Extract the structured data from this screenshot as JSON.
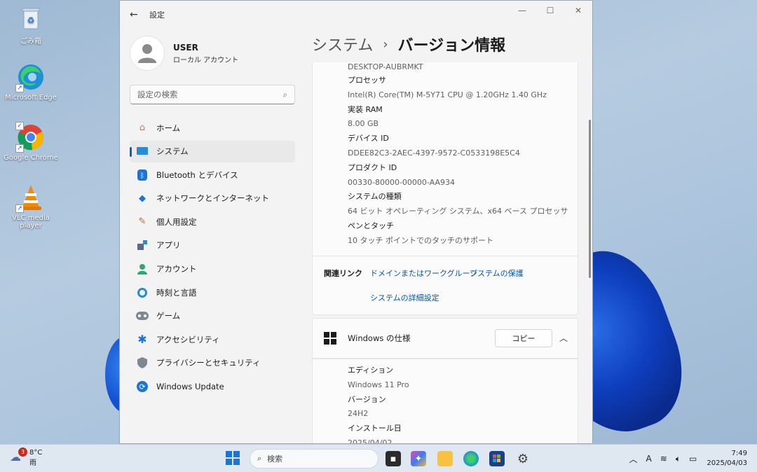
{
  "desktop": {
    "icons": [
      {
        "label": "ごみ箱"
      },
      {
        "label": "Microsoft Edge"
      },
      {
        "label": "Google Chrome"
      },
      {
        "label": "VLC media player"
      }
    ]
  },
  "window": {
    "title": "設定",
    "user": {
      "name": "USER",
      "account": "ローカル アカウント"
    },
    "search_placeholder": "設定の検索",
    "nav": [
      {
        "label": "ホーム",
        "icon": "home-icon"
      },
      {
        "label": "システム",
        "icon": "system-icon",
        "active": true
      },
      {
        "label": "Bluetooth とデバイス",
        "icon": "bluetooth-icon"
      },
      {
        "label": "ネットワークとインターネット",
        "icon": "network-icon"
      },
      {
        "label": "個人用設定",
        "icon": "brush-icon"
      },
      {
        "label": "アプリ",
        "icon": "apps-icon"
      },
      {
        "label": "アカウント",
        "icon": "account-icon"
      },
      {
        "label": "時刻と言語",
        "icon": "globe-clock-icon"
      },
      {
        "label": "ゲーム",
        "icon": "gamepad-icon"
      },
      {
        "label": "アクセシビリティ",
        "icon": "accessibility-icon"
      },
      {
        "label": "プライバシーとセキュリティ",
        "icon": "shield-icon"
      },
      {
        "label": "Windows Update",
        "icon": "update-icon"
      }
    ],
    "breadcrumb": {
      "parent": "システム",
      "separator": "›",
      "current": "バージョン情報"
    },
    "device_specs": {
      "device_name_value": "DESKTOP-AUBRMKT",
      "rows": [
        {
          "label": "プロセッサ",
          "value": "Intel(R) Core(TM) M-5Y71 CPU @ 1.20GHz   1.40 GHz"
        },
        {
          "label": "実装 RAM",
          "value": "8.00 GB"
        },
        {
          "label": "デバイス ID",
          "value": "DDEE82C3-2AEC-4397-9572-C0533198E5C4"
        },
        {
          "label": "プロダクト ID",
          "value": "00330-80000-00000-AA934"
        },
        {
          "label": "システムの種類",
          "value": "64 ビット オペレーティング システム、x64 ベース プロセッサ"
        },
        {
          "label": "ペンとタッチ",
          "value": "10 タッチ ポイントでのタッチのサポート"
        }
      ]
    },
    "related_links": {
      "title": "関連リンク",
      "links": [
        "ドメインまたはワークグループ",
        "システムの保護",
        "システムの詳細設定"
      ]
    },
    "windows_spec": {
      "title": "Windows の仕様",
      "copy_label": "コピー",
      "rows": [
        {
          "label": "エディション",
          "value": "Windows 11 Pro"
        },
        {
          "label": "バージョン",
          "value": "24H2"
        },
        {
          "label": "インストール日",
          "value": "2025/04/02"
        }
      ]
    }
  },
  "taskbar": {
    "weather": {
      "temp": "8°C",
      "condition": "雨",
      "badge": "3"
    },
    "search_placeholder": "検索",
    "ime": "A",
    "time": "7:49",
    "date": "2025/04/03"
  },
  "colors": {
    "accent": "#0067c0",
    "link": "#0055a8"
  }
}
